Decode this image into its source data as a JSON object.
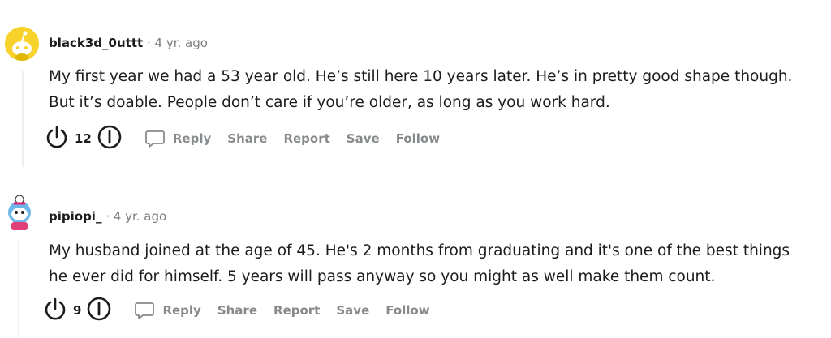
{
  "comments": [
    {
      "author": "black3d_0uttt",
      "separator": "·",
      "time": "4 yr. ago",
      "lines": [
        "My first year we had a 53 year old. He’s still here 10 years later. He’s in pretty good shape though.",
        "But it’s doable. People don’t care if you’re older, as long as you work hard."
      ],
      "score": "12",
      "actions": {
        "reply": "Reply",
        "share": "Share",
        "report": "Report",
        "save": "Save",
        "follow": "Follow"
      }
    },
    {
      "author": "pipiopi_",
      "separator": "·",
      "time": "4 yr. ago",
      "lines": [
        "My husband joined at the age of 45. He's 2 months from graduating and it's one of the best things",
        "he ever did for himself. 5 years will pass anyway so you might as well make them count."
      ],
      "score": "9",
      "actions": {
        "reply": "Reply",
        "share": "Share",
        "report": "Report",
        "save": "Save",
        "follow": "Follow"
      }
    }
  ],
  "icons": {
    "upvote": "upvote-icon",
    "downvote": "downvote-icon",
    "reply": "speech-bubble-icon"
  },
  "colors": {
    "text": "#1c1c1c",
    "muted": "#878a8c",
    "avatar1_bg": "#f7d22b"
  }
}
